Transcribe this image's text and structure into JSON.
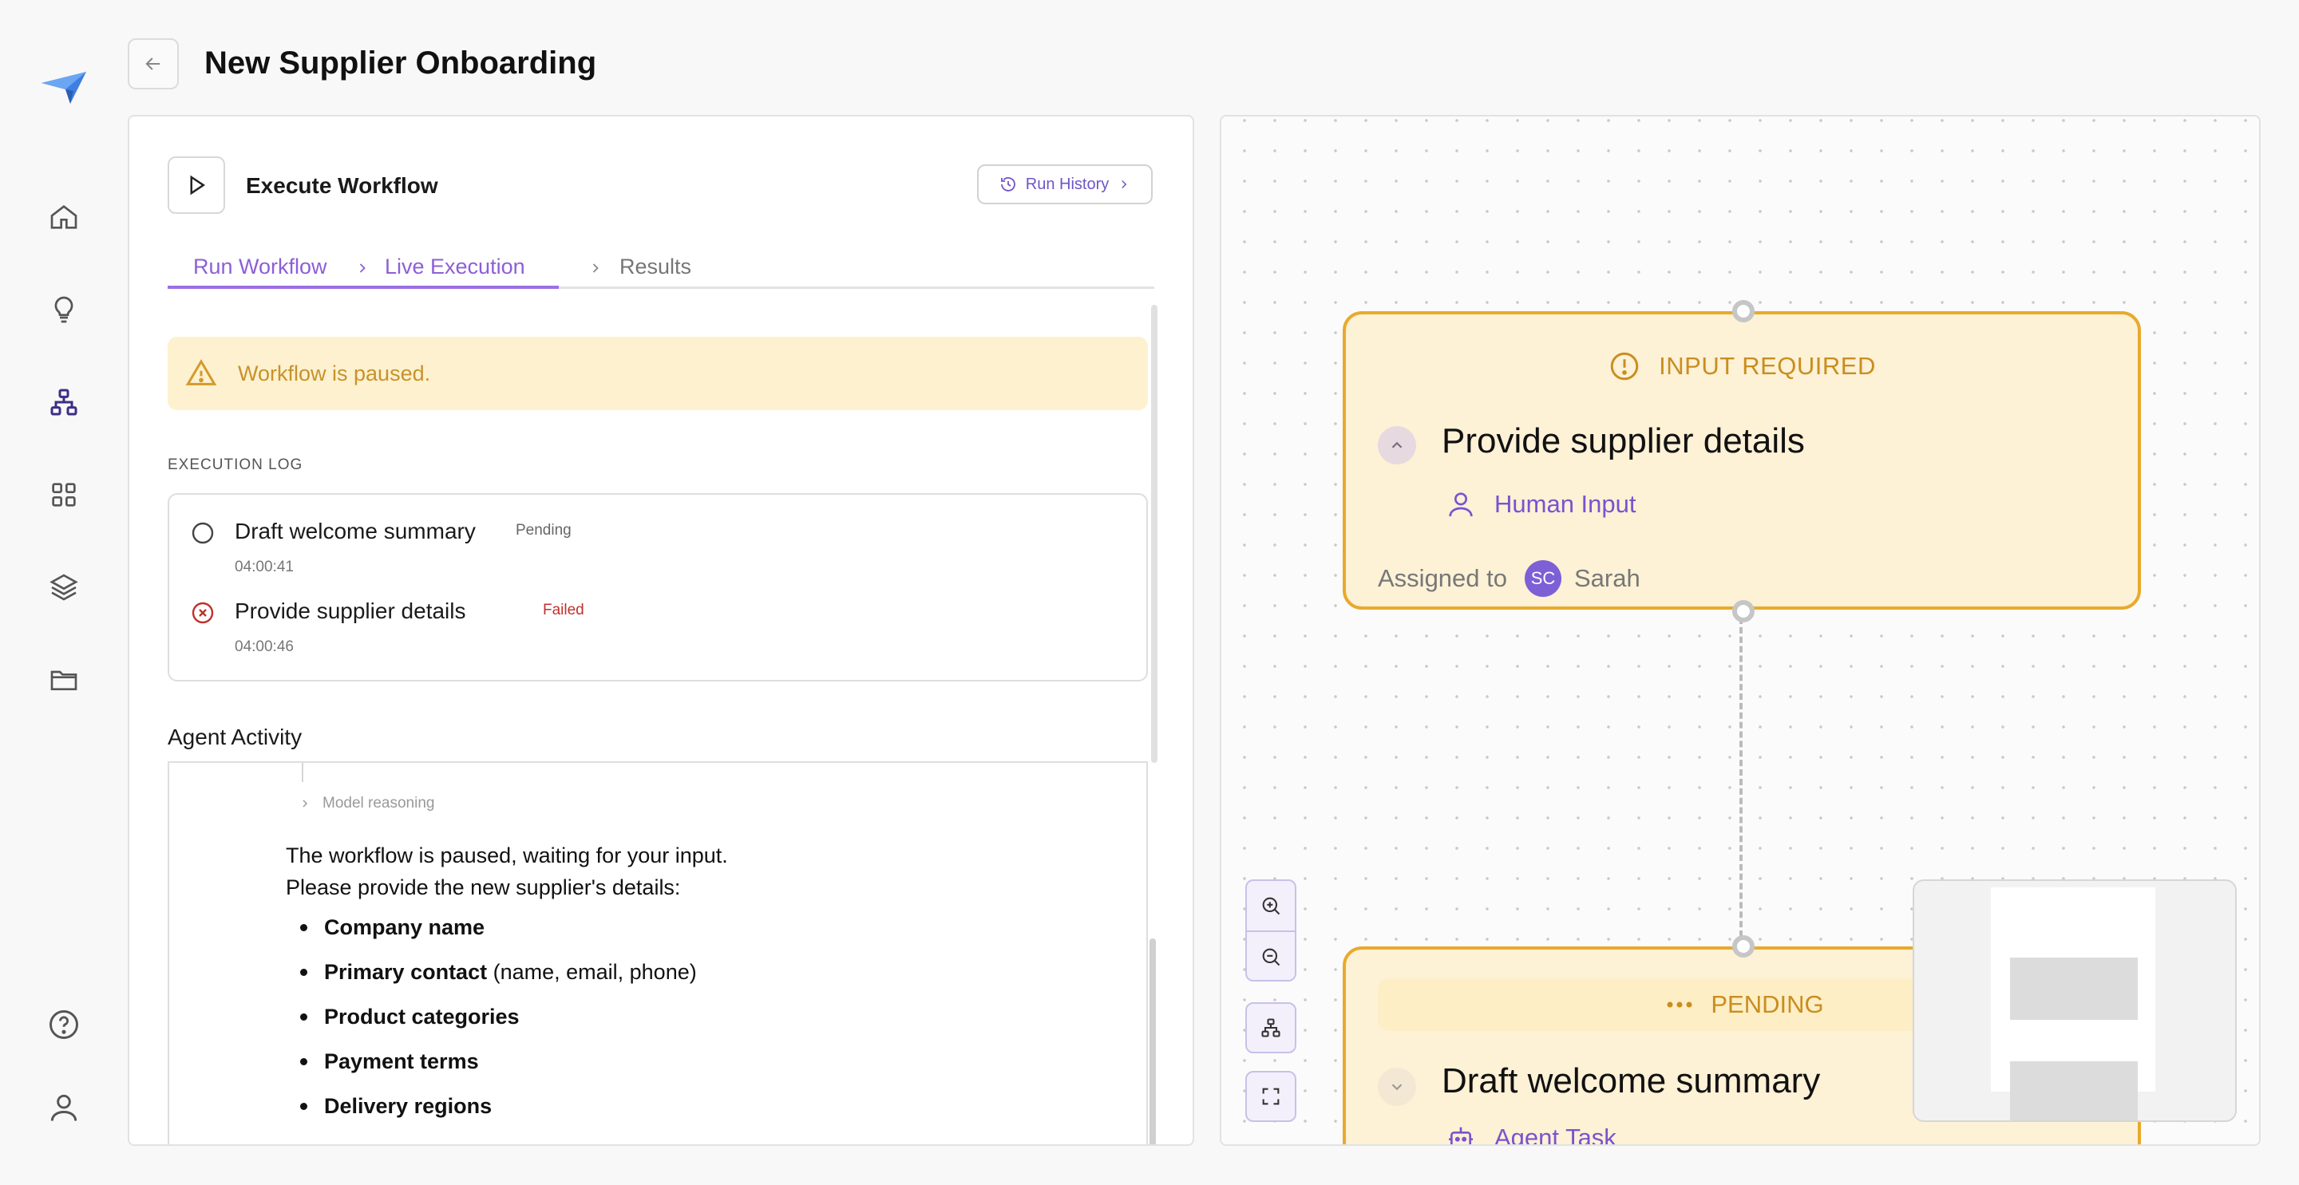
{
  "header": {
    "title": "New Supplier Onboarding"
  },
  "sidebar": {
    "items": [
      {
        "name": "home",
        "icon": "home-icon"
      },
      {
        "name": "ideas",
        "icon": "lightbulb-icon"
      },
      {
        "name": "workflows",
        "icon": "workflow-icon"
      },
      {
        "name": "apps",
        "icon": "grid-icon"
      },
      {
        "name": "layers",
        "icon": "layers-icon"
      },
      {
        "name": "files",
        "icon": "folder-icon"
      },
      {
        "name": "help",
        "icon": "help-icon"
      },
      {
        "name": "profile",
        "icon": "user-icon"
      }
    ]
  },
  "execute": {
    "title": "Execute Workflow",
    "run_history_label": "Run History"
  },
  "tabs": [
    {
      "label": "Run Workflow",
      "state": "active"
    },
    {
      "label": "Live Execution",
      "state": "active"
    },
    {
      "label": "Results",
      "state": "inactive"
    }
  ],
  "alert": {
    "text": "Workflow is paused."
  },
  "execution_log": {
    "label": "EXECUTION LOG",
    "items": [
      {
        "title": "Draft welcome summary",
        "status": "Pending",
        "time": "04:00:41"
      },
      {
        "title": "Provide supplier details",
        "status": "Failed",
        "time": "04:00:46"
      }
    ]
  },
  "agent_activity": {
    "title": "Agent Activity",
    "reasoning_label": "Model reasoning",
    "line1": "The workflow is paused, waiting for your input.",
    "line2": "Please provide the new supplier's details:",
    "list": [
      {
        "bold": "Company name",
        "rest": ""
      },
      {
        "bold": "Primary contact",
        "rest": " (name, email, phone)"
      },
      {
        "bold": "Product categories",
        "rest": ""
      },
      {
        "bold": "Payment terms",
        "rest": ""
      },
      {
        "bold": "Delivery regions",
        "rest": ""
      }
    ]
  },
  "nodes": {
    "node1": {
      "status": "INPUT REQUIRED",
      "title": "Provide supplier details",
      "type": "Human Input",
      "assigned_label": "Assigned to",
      "assignee_initials": "SC",
      "assignee_name": "Sarah"
    },
    "node2": {
      "status": "PENDING",
      "title": "Draft welcome summary",
      "type": "Agent Task"
    }
  },
  "colors": {
    "accent": "#8d5fd8",
    "warning": "#e8aa2d",
    "failed": "#c0312b",
    "node_bg": "#fdf1d6"
  }
}
